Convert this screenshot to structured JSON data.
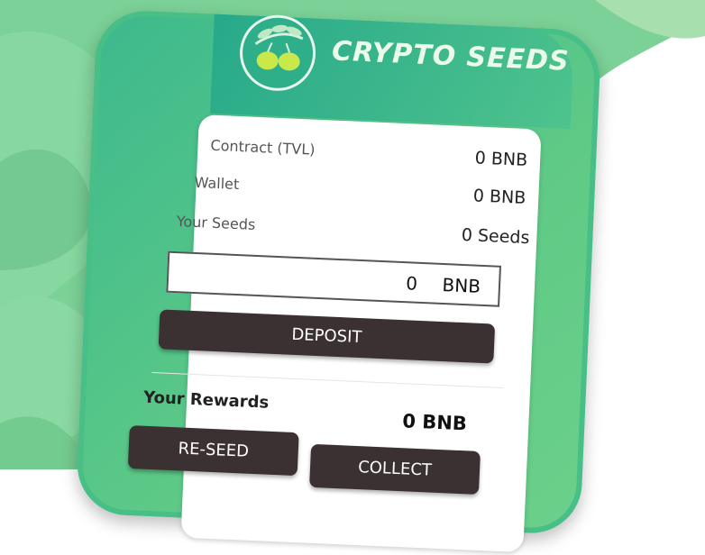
{
  "brand": {
    "name": "CRYPTO SEEDS",
    "logo_icon": "olive-branch-icon"
  },
  "stats": [
    {
      "label": "Contract (TVL)",
      "value": "0 BNB"
    },
    {
      "label": "Wallet",
      "value": "0 BNB"
    },
    {
      "label": "Your Seeds",
      "value": "0 Seeds"
    }
  ],
  "deposit_input": {
    "value": "0",
    "unit": "BNB"
  },
  "buttons": {
    "deposit": "DEPOSIT",
    "reseed": "RE-SEED",
    "collect": "COLLECT"
  },
  "rewards": {
    "label": "Your Rewards",
    "value": "0 BNB"
  },
  "colors": {
    "background_green": "#7fd39a",
    "phone_green": "#4ec38d",
    "button_dark": "#3b3132",
    "card": "#ffffff"
  }
}
